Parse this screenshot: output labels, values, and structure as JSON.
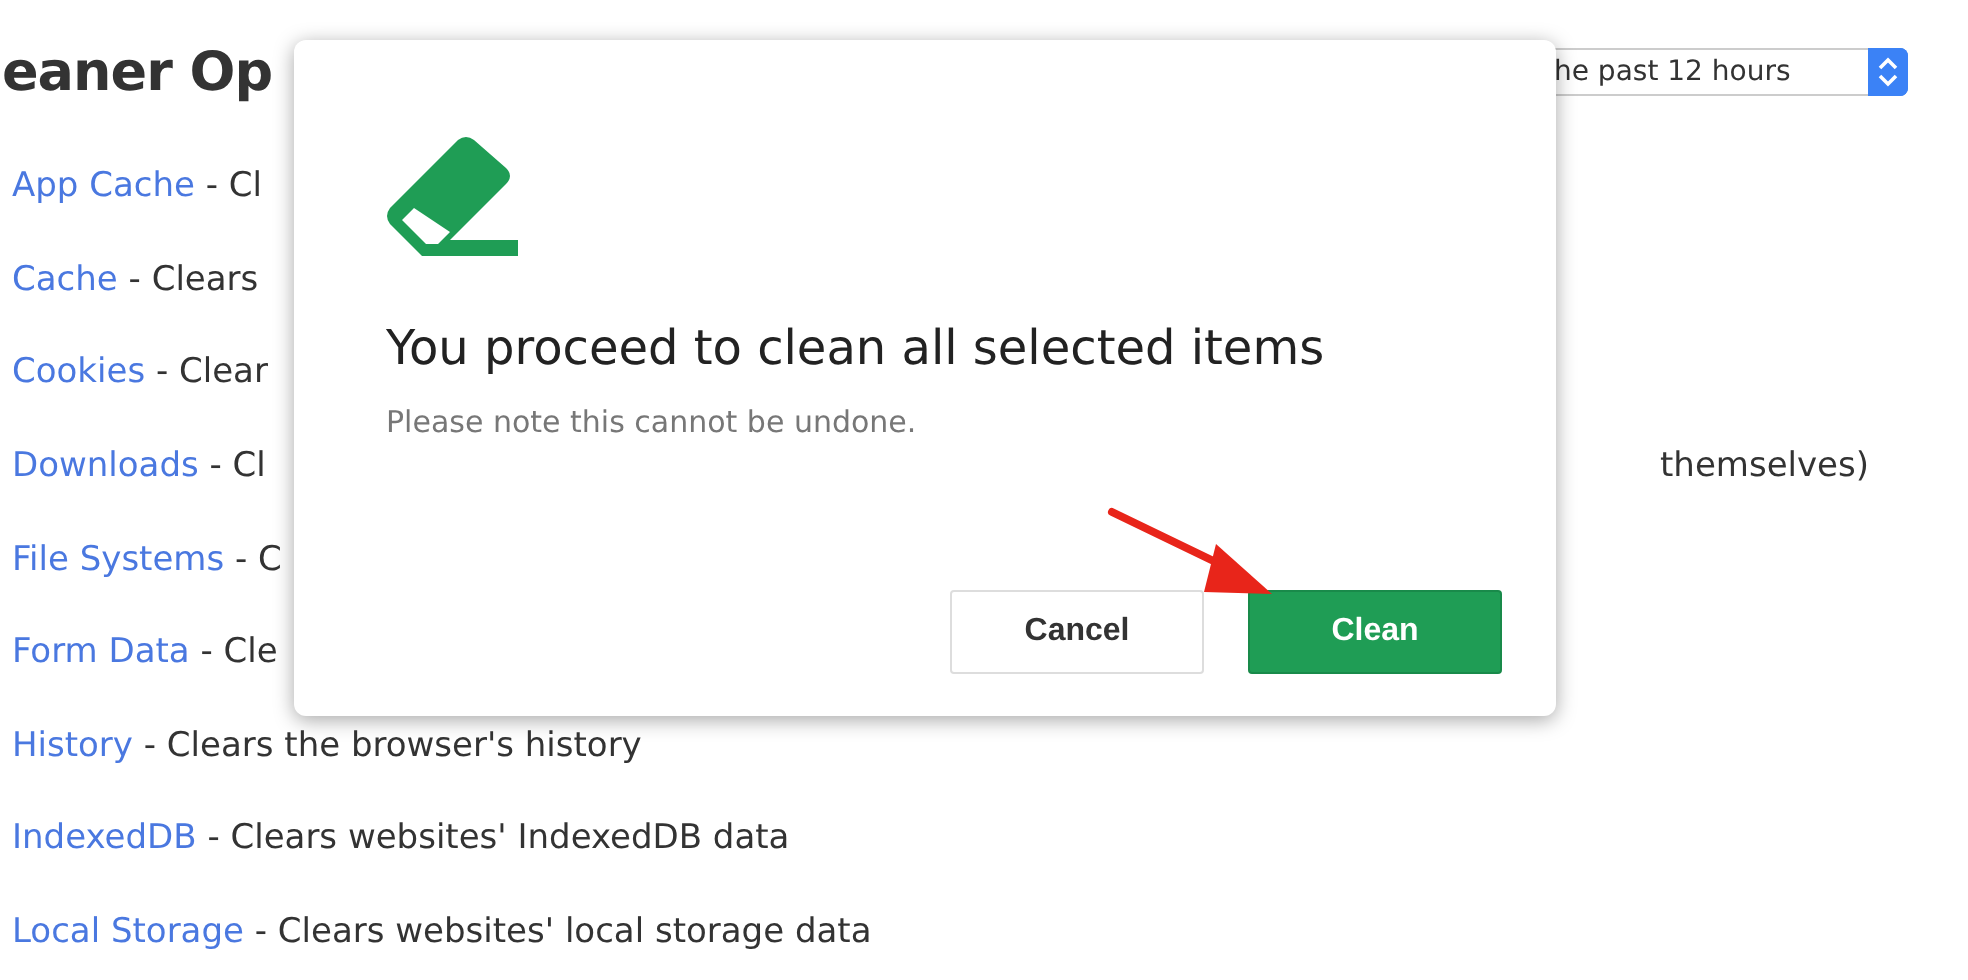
{
  "page": {
    "heading": "eaner Op",
    "time_range": {
      "value": "he past 12 hours"
    },
    "items": [
      {
        "name": "App Cache",
        "description": "- Cl"
      },
      {
        "name": "Cache",
        "description": "- Clears"
      },
      {
        "name": "Cookies",
        "description": "- Clear"
      },
      {
        "name": "Downloads",
        "description": "- Cl",
        "trailing": "themselves)"
      },
      {
        "name": "File Systems",
        "description": "- C"
      },
      {
        "name": "Form Data",
        "description": "- Cle"
      },
      {
        "name": "History",
        "description": "- Clears the browser's history"
      },
      {
        "name": "IndexedDB",
        "description": "- Clears websites' IndexedDB data"
      },
      {
        "name": "Local Storage",
        "description": "- Clears websites' local storage data"
      }
    ]
  },
  "dialog": {
    "title": "You proceed to clean all selected items",
    "message": "Please note this cannot be undone.",
    "buttons": [
      {
        "label": "Cancel",
        "kind": "secondary"
      },
      {
        "label": "Clean",
        "kind": "primary"
      }
    ]
  }
}
